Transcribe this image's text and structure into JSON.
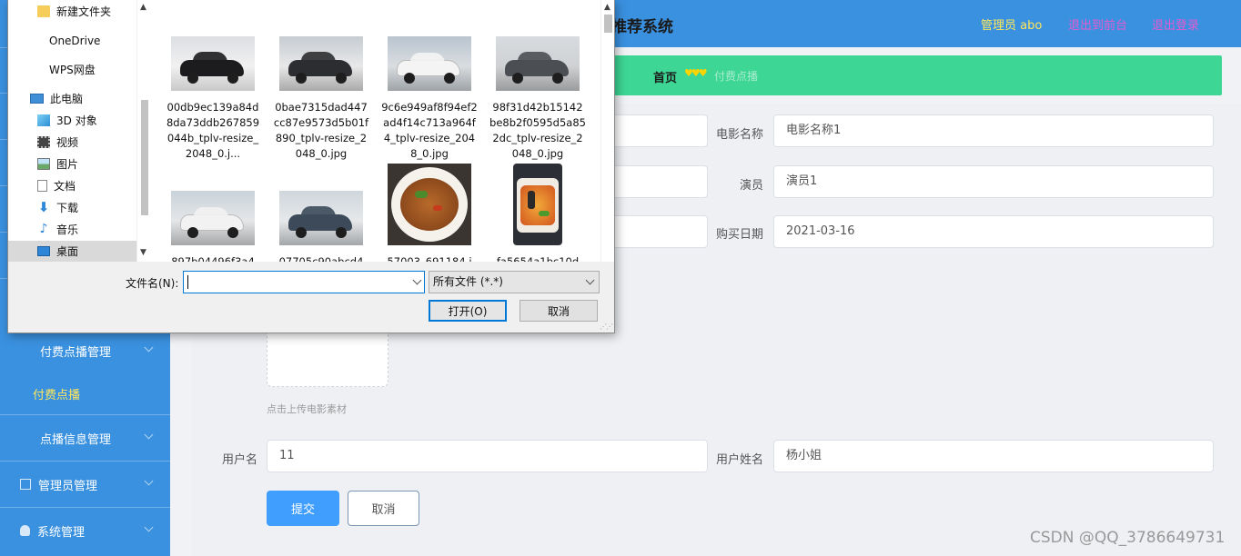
{
  "app": {
    "title": "推荐系统",
    "admin_label": "管理员 abo",
    "to_front_label": "退出到前台",
    "logout_label": "退出登录",
    "colors": {
      "sidebar": "#3a91e0",
      "breadcrumb_bg": "#3dd694",
      "accent": "#409eff",
      "highlight": "#ffe65c",
      "link": "#e45cd0"
    }
  },
  "breadcrumb": {
    "home": "首页",
    "separator": "♥♥♥",
    "current": "付费点播"
  },
  "sidebar": {
    "groups": [
      {
        "label": "付费点播管理",
        "icon": "grid-icon"
      },
      {
        "label": "点播信息管理",
        "icon": "grid-icon"
      },
      {
        "label": "管理员管理",
        "icon": "square-icon"
      },
      {
        "label": "系统管理",
        "icon": "bulb-icon"
      }
    ],
    "sub_items": [
      {
        "label": "付费点播",
        "active": true
      }
    ]
  },
  "form": {
    "fields": [
      {
        "label": "电影名称",
        "value": "电影名称1"
      },
      {
        "label": "演员",
        "value": "演员1"
      },
      {
        "label": "购买日期",
        "value": "2021-03-16"
      },
      {
        "label": "用户名",
        "value": "11"
      },
      {
        "label": "用户姓名",
        "value": "杨小姐"
      }
    ],
    "upload_tip": "点击上传电影素材",
    "submit_label": "提交",
    "cancel_label": "取消"
  },
  "dialog": {
    "nav_items": [
      {
        "label": "新建文件夹",
        "icon": "folder-icon"
      },
      {
        "label": "OneDrive",
        "icon": ""
      },
      {
        "label": "WPS网盘",
        "icon": ""
      },
      {
        "label": "此电脑",
        "icon": "computer-icon"
      },
      {
        "label": "3D 对象",
        "icon": "cube-icon"
      },
      {
        "label": "视频",
        "icon": "video-icon"
      },
      {
        "label": "图片",
        "icon": "picture-icon"
      },
      {
        "label": "文档",
        "icon": "document-icon"
      },
      {
        "label": "下载",
        "icon": "download-icon"
      },
      {
        "label": "音乐",
        "icon": "music-icon"
      },
      {
        "label": "桌面",
        "icon": "desktop-icon",
        "selected": true
      }
    ],
    "files": [
      {
        "name": "00db9ec139a84d8da73ddb267859044b_tplv-resize_2048_0.j...",
        "kind": "car-black"
      },
      {
        "name": "0bae7315dad447cc87e9573d5b01f890_tplv-resize_2048_0.jpg",
        "kind": "car-black"
      },
      {
        "name": "9c6e949af8f94ef2ad4f14c713a964f4_tplv-resize_2048_0.jpg",
        "kind": "car-white"
      },
      {
        "name": "98f31d42b15142be8b2f0595d5a852dc_tplv-resize_2048_0.jpg",
        "kind": "car-gray"
      },
      {
        "name": "897b04496f3a4",
        "kind": "car-white"
      },
      {
        "name": "07705c90abcd4",
        "kind": "car-blue"
      },
      {
        "name": "57003_691184.j",
        "kind": "food-dish"
      },
      {
        "name": "fa5654a1bc10d",
        "kind": "food-phone"
      }
    ],
    "filename_label": "文件名(N):",
    "filename_value": "",
    "filter_value": "所有文件 (*.*)",
    "open_label": "打开(O)",
    "cancel_label": "取消"
  },
  "watermark": "CSDN @QQ_3786649731"
}
